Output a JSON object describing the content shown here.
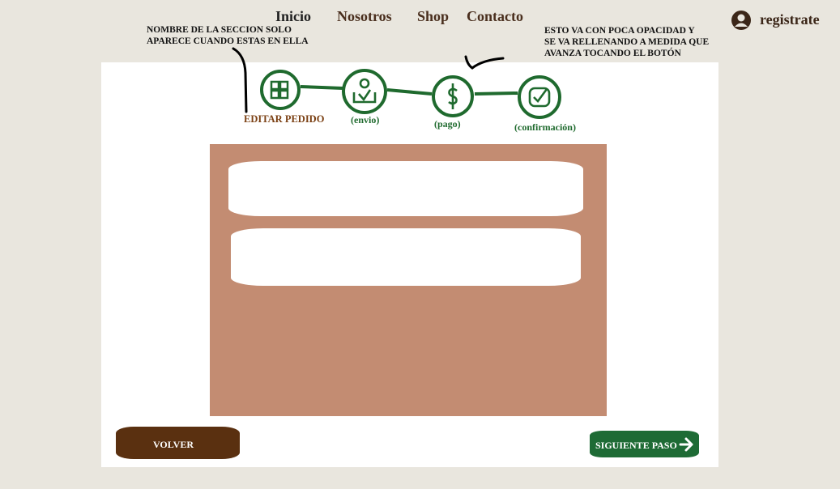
{
  "nav": {
    "inicio": "Inicio",
    "nosotros": "Nosotros",
    "shop": "Shop",
    "contacto": "Contacto"
  },
  "user": {
    "label": "registrate",
    "icon": "user-avatar-icon"
  },
  "notes": {
    "left": "NOMBRE DE LA SECCION SOLO\nAPARECE CUANDO ESTAS EN ELLA",
    "right": "ESTO VA CON POCA OPACIDAD Y\nSE VA RELLENANDO A MEDIDA QUE\nAVANZA TOCANDO EL BOTÓN"
  },
  "steps": [
    {
      "label": "EDITAR PEDIDO",
      "icon": "edit-order-icon"
    },
    {
      "label": "(envio)",
      "icon": "shipping-box-icon"
    },
    {
      "label": "(pago)",
      "icon": "dollar-icon"
    },
    {
      "label": "(confirmación)",
      "icon": "check-icon"
    }
  ],
  "buttons": {
    "back": "VOLVER",
    "next": "SIGUIENTE PASO"
  },
  "colors": {
    "background": "#e9e6de",
    "card": "#ffffff",
    "panel": "#c38c72",
    "stepper_green": "#1f6a2e",
    "back_button": "#5a3010",
    "next_button": "#1e6b35",
    "active_step_label": "#7a3f12"
  }
}
